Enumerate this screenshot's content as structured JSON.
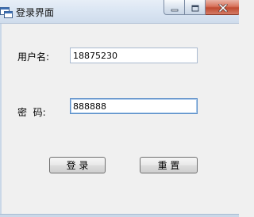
{
  "window": {
    "title": "登录界面"
  },
  "form": {
    "username_label": "用户名:",
    "username_value": "18875230",
    "password_label": "密  码:",
    "password_value": "888888"
  },
  "buttons": {
    "login_label": "登 录",
    "reset_label": "重 置"
  },
  "icons": {
    "app": "app-window-icon",
    "minimize": "minimize-icon",
    "maximize": "maximize-icon",
    "close": "close-icon"
  },
  "colors": {
    "window_background": "#f0f0f0",
    "titlebar": "#dbe6f3",
    "close_button": "#c04a30",
    "focused_input_border": "#5c8fc9"
  }
}
